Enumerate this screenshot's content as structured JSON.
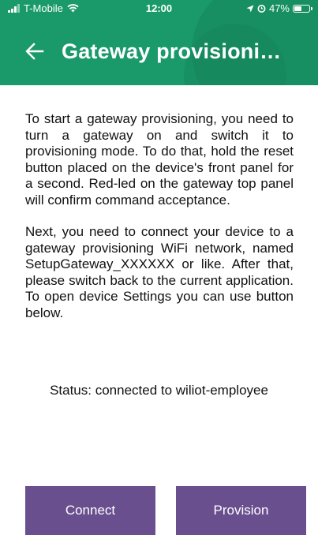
{
  "status_bar": {
    "carrier": "T-Mobile",
    "time": "12:00",
    "battery_percent": "47%",
    "battery_level": 0.47
  },
  "header": {
    "title": "Gateway provisioni…",
    "background_color": "#1a9a6a",
    "back_icon": "arrow-left-icon"
  },
  "content": {
    "paragraph_1": "To start a gateway provisioning, you need to turn a gateway on and switch it to provisioning mode. To do that, hold the reset button placed on the device's front panel for a second. Red-led on the gateway top panel will confirm command acceptance.",
    "paragraph_2": "Next, you need to connect your device to a gateway provisioning WiFi network, named SetupGateway_XXXXXX or like. After that, please switch back to the current application. To open device Settings you can use button below."
  },
  "status": {
    "text": "Status: connected to wiliot-employee"
  },
  "buttons": {
    "connect_label": "Connect",
    "provision_label": "Provision",
    "color": "#6a4f8e"
  }
}
